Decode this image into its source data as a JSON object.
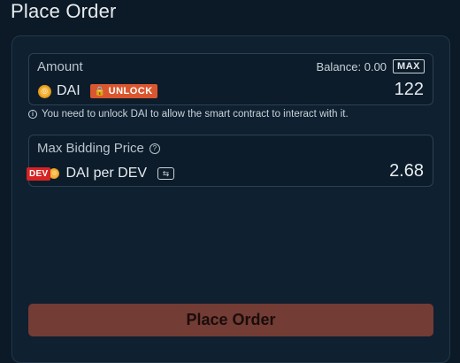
{
  "page": {
    "title": "Place Order"
  },
  "amount": {
    "label": "Amount",
    "balance_text": "Balance: 0.00",
    "max_label": "MAX",
    "token": "DAI",
    "coin_glyph": "◎",
    "unlock_label": "UNLOCK",
    "lock_glyph": "🔒",
    "value": "122"
  },
  "notice": {
    "info_glyph": "i",
    "text": "You need to unlock DAI to allow the smart contract to interact with it."
  },
  "price": {
    "label": "Max Bidding Price",
    "help_glyph": "?",
    "dev_badge": "DEV",
    "coin_glyph": "◎",
    "pair": "DAI per DEV",
    "swap_glyph": "⇆",
    "value": "2.68"
  },
  "submit": {
    "label": "Place Order"
  },
  "colors": {
    "background": "#0b1a26",
    "unlock": "#d9572f",
    "dev": "#d62324",
    "dai": "#f3b53a",
    "button": "#733c34"
  },
  "icons": [
    "dai-coin-icon",
    "lock-icon",
    "info-icon",
    "help-icon",
    "swap-icon"
  ]
}
